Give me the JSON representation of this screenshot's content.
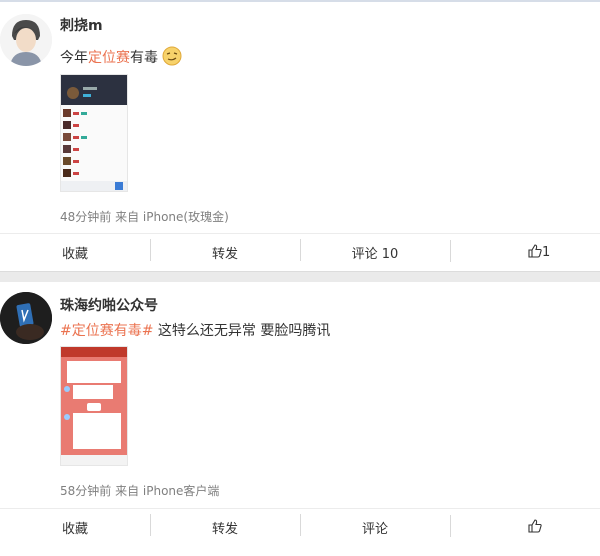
{
  "posts": [
    {
      "username": "刺挠m",
      "content": {
        "prefix": "今年",
        "highlight": "定位赛",
        "suffix": "有毒"
      },
      "emoji": "smirk-emoji",
      "meta": "48分钟前 来自 iPhone(玫瑰金)",
      "actions": {
        "favorite": "收藏",
        "repost": "转发",
        "comment": "评论 10",
        "like": "1"
      }
    },
    {
      "username": "珠海约啪公众号",
      "content": {
        "topic": "#定位赛有毒#",
        "text": " 这特么还无异常 要脸吗腾讯"
      },
      "meta": "58分钟前 来自 iPhone客户端",
      "actions": {
        "favorite": "收藏",
        "repost": "转发",
        "comment": "评论",
        "like": ""
      }
    }
  ],
  "colors": {
    "accent": "#eb7350",
    "meta": "#808080",
    "separator": "#eaeaea"
  }
}
